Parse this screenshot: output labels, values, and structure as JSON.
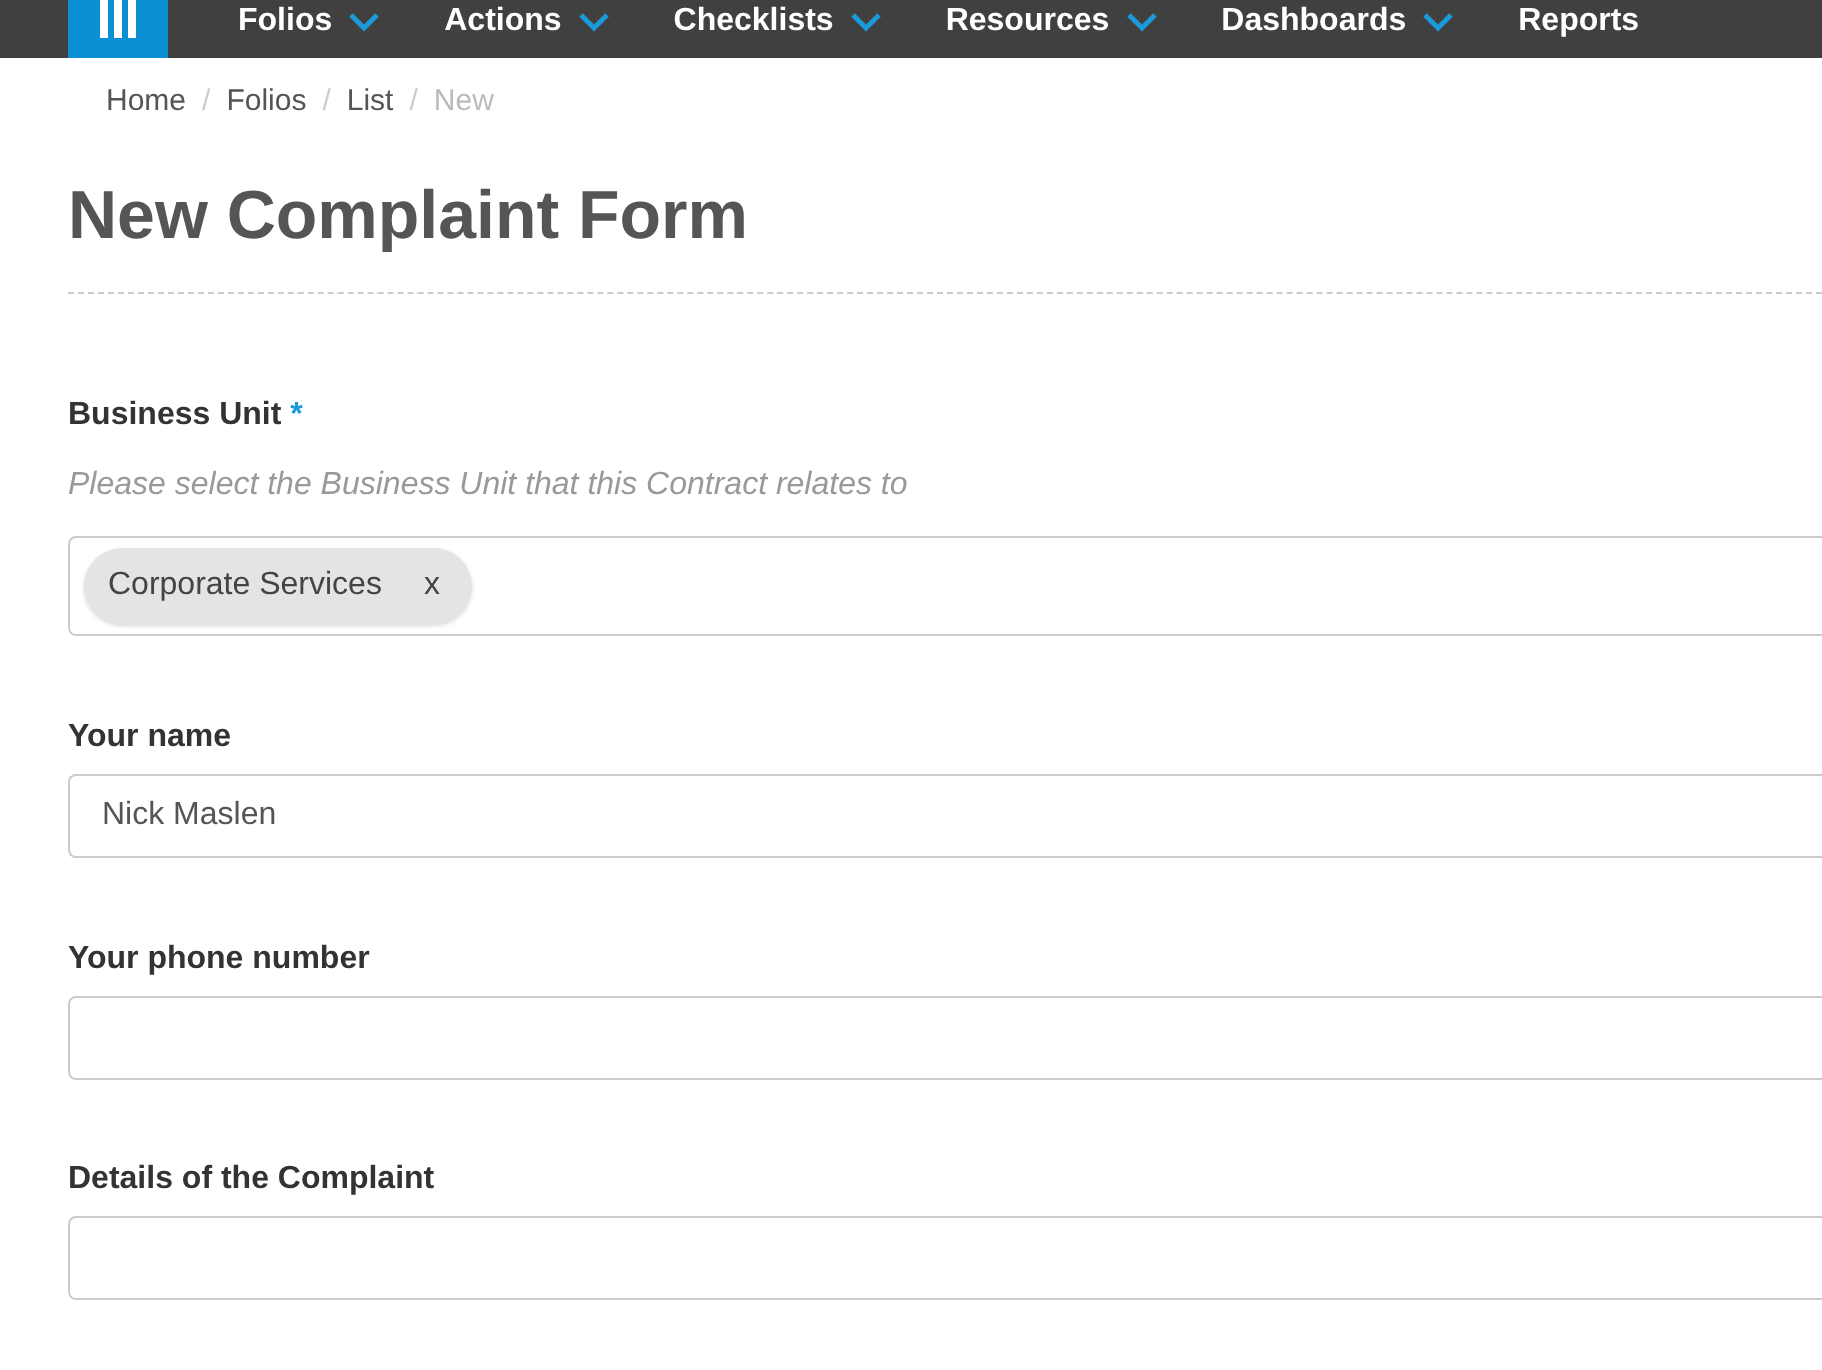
{
  "nav": {
    "items": [
      {
        "label": "Folios",
        "has_menu": true
      },
      {
        "label": "Actions",
        "has_menu": true
      },
      {
        "label": "Checklists",
        "has_menu": true
      },
      {
        "label": "Resources",
        "has_menu": true
      },
      {
        "label": "Dashboards",
        "has_menu": true
      },
      {
        "label": "Reports",
        "has_menu": false
      }
    ]
  },
  "breadcrumb": [
    {
      "label": "Home",
      "current": false
    },
    {
      "label": "Folios",
      "current": false
    },
    {
      "label": "List",
      "current": false
    },
    {
      "label": "New",
      "current": true
    }
  ],
  "breadcrumb_separator": "/",
  "page": {
    "title": "New Complaint Form"
  },
  "form": {
    "fields": [
      {
        "kind": "multiselect",
        "label": "Business Unit",
        "required_mark": "*",
        "help": "Please select the Business Unit that this Contract relates to",
        "chips": [
          {
            "label": "Corporate Services",
            "remove": "x"
          }
        ]
      },
      {
        "kind": "text",
        "label": "Your name",
        "value": "Nick Maslen"
      },
      {
        "kind": "text",
        "label": "Your phone number"
      },
      {
        "kind": "text",
        "label": "Details of the Complaint"
      }
    ]
  }
}
